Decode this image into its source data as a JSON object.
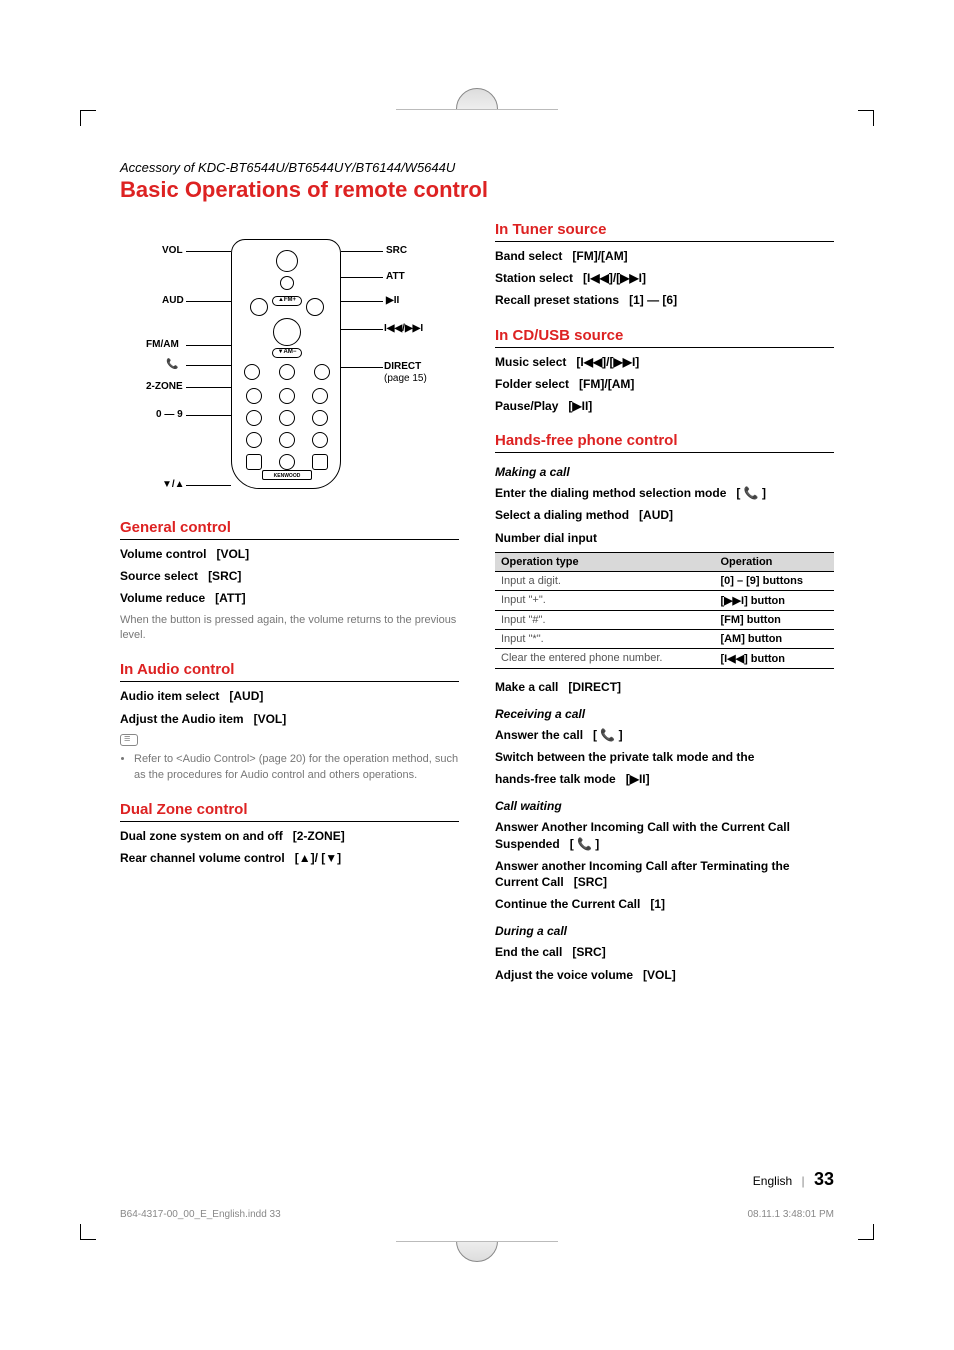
{
  "header": {
    "accessory_line": "Accessory of KDC-BT6544U/BT6544UY/BT6144/W5644U",
    "title": "Basic Operations of remote control"
  },
  "remote_labels": {
    "vol": "VOL",
    "aud": "AUD",
    "fm_am": "FM/AM",
    "phone": "",
    "two_zone": "2-ZONE",
    "digits": "0 — 9",
    "down_up": "▼/▲",
    "src": "SRC",
    "att": "ATT",
    "play_pause": "▶II",
    "prev_next": "I◀◀/▶▶I",
    "direct": "DIRECT",
    "direct_page": "(page 15)"
  },
  "general": {
    "heading": "General control",
    "vol_label": "Volume control",
    "vol_btn": "[VOL]",
    "src_label": "Source select",
    "src_btn": "[SRC]",
    "reduce_label": "Volume reduce",
    "reduce_btn": "[ATT]",
    "reduce_note": "When the button is pressed again, the volume returns to the previous level."
  },
  "audio": {
    "heading": "In Audio control",
    "item_label": "Audio item select",
    "item_btn": "[AUD]",
    "adjust_label": "Adjust the Audio item",
    "adjust_btn": "[VOL]",
    "note_bullet": "Refer to <Audio Control> (page 20) for the operation method, such as the procedures for Audio control and others operations."
  },
  "dualzone": {
    "heading": "Dual Zone control",
    "onoff_label": "Dual zone system on and off",
    "onoff_btn": "[2-ZONE]",
    "rear_label": "Rear channel volume control",
    "rear_btn": "[▲]/ [▼]"
  },
  "tuner": {
    "heading": "In Tuner source",
    "band_label": "Band select",
    "band_btn": "[FM]/[AM]",
    "station_label": "Station select",
    "station_btn": "[I◀◀]/[▶▶I]",
    "recall_label": "Recall preset stations",
    "recall_btn": "[1] — [6]"
  },
  "cdusb": {
    "heading": "In CD/USB source",
    "music_label": "Music select",
    "music_btn": "[I◀◀]/[▶▶I]",
    "folder_label": "Folder select",
    "folder_btn": "[FM]/[AM]",
    "pause_label": "Pause/Play",
    "pause_btn": "[▶II]"
  },
  "hands": {
    "heading": "Hands-free phone control",
    "making_heading": "Making a call",
    "enter_label": "Enter the dialing method selection mode",
    "enter_btn": "[ 📞 ]",
    "select_label": "Select a dialing method",
    "select_btn": "[AUD]",
    "number_label": "Number dial input",
    "table": {
      "h1": "Operation type",
      "h2": "Operation",
      "rows": [
        {
          "t": "Input a digit.",
          "o": "[0] – [9] buttons"
        },
        {
          "t": "Input \"+\".",
          "o": "[▶▶I] button"
        },
        {
          "t": "Input \"#\".",
          "o": "[FM] button"
        },
        {
          "t": "Input \"*\".",
          "o": "[AM] button"
        },
        {
          "t": "Clear the entered phone number.",
          "o": "[I◀◀] button"
        }
      ]
    },
    "make_label": "Make a call",
    "make_btn": "[DIRECT]",
    "receiving_heading": "Receiving a call",
    "answer_label": "Answer the call",
    "answer_btn": "[ 📞 ]",
    "switch_label": "Switch between the private talk mode and the",
    "switch_label2": "hands-free talk mode",
    "switch_btn": "[▶II]",
    "waiting_heading": "Call waiting",
    "wait1_label": "Answer Another Incoming Call with the Current Call Suspended",
    "wait1_btn": "[ 📞 ]",
    "wait2_label": "Answer another Incoming Call after Terminating the Current Call",
    "wait2_btn": "[SRC]",
    "wait3_label": "Continue the Current Call",
    "wait3_btn": "[1]",
    "during_heading": "During a call",
    "end_label": "End the call",
    "end_btn": "[SRC]",
    "voice_label": "Adjust the voice volume",
    "voice_btn": "[VOL]"
  },
  "footer": {
    "lang": "English",
    "page": "33",
    "indd": "B64-4317-00_00_E_English.indd   33",
    "timestamp": "08.11.1   3:48:01 PM"
  }
}
